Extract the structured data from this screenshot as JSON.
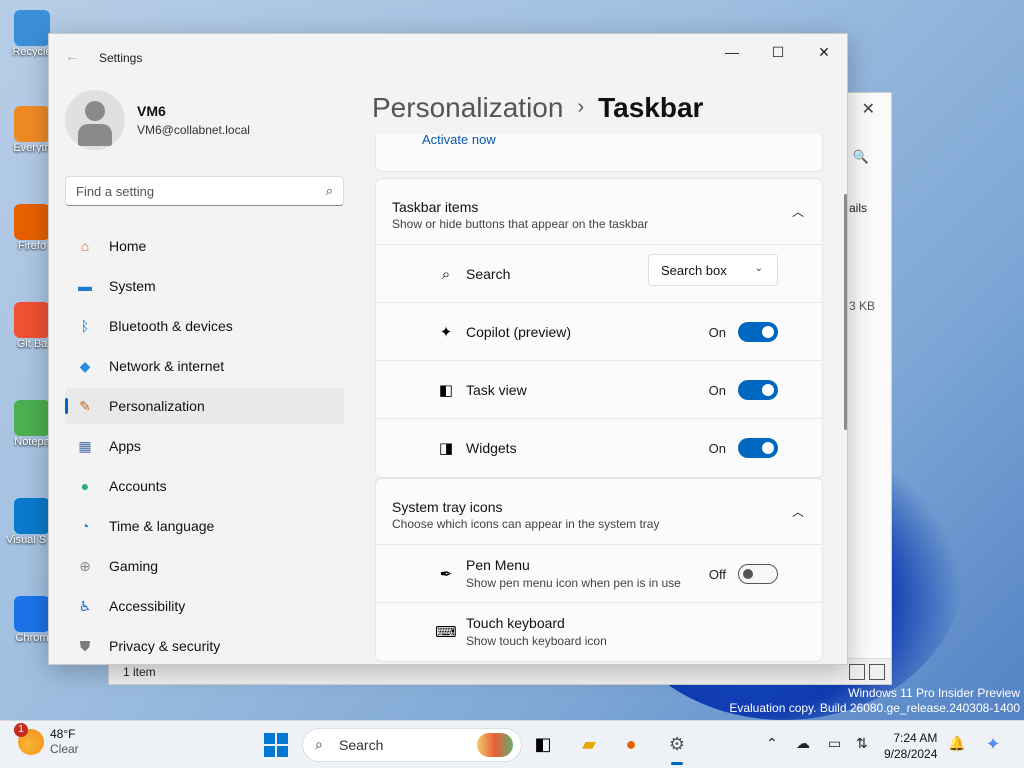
{
  "desktop": {
    "icons": [
      {
        "label": "Recycle",
        "icon": "recycle-bin-icon",
        "color": "#3a8fd8"
      },
      {
        "label": "Everyth",
        "icon": "everything-search-icon",
        "color": "#f08a24"
      },
      {
        "label": "Firefo",
        "icon": "firefox-icon",
        "color": "#e66000"
      },
      {
        "label": "Git Ba",
        "icon": "git-bash-icon",
        "color": "#f05033"
      },
      {
        "label": "Notepa",
        "icon": "notepad-icon",
        "color": "#4caf50"
      },
      {
        "label": "Visual S Code",
        "icon": "vscode-icon",
        "color": "#0a7acc"
      },
      {
        "label": "Chrom",
        "icon": "chrome-icon",
        "color": "#1a73e8"
      }
    ]
  },
  "explorer": {
    "close_glyph": "✕",
    "search_glyph": "🔍",
    "details_label": "ails",
    "size_label": "3 KB",
    "status_text": "1 item"
  },
  "settings": {
    "window_title": "Settings",
    "back_glyph": "←",
    "controls": {
      "minimize": "—",
      "maximize": "☐",
      "close": "✕"
    },
    "user": {
      "name": "VM6",
      "email": "VM6@collabnet.local"
    },
    "search": {
      "placeholder": "Find a setting",
      "glyph": "⌕"
    },
    "nav": [
      {
        "label": "Home",
        "icon": "home-icon",
        "glyph": "⌂",
        "color": "#e0683b",
        "active": false
      },
      {
        "label": "System",
        "icon": "system-icon",
        "glyph": "▬",
        "color": "#1a7fd4",
        "active": false
      },
      {
        "label": "Bluetooth & devices",
        "icon": "bluetooth-icon",
        "glyph": "ᛒ",
        "color": "#0a6fd8",
        "active": false
      },
      {
        "label": "Network & internet",
        "icon": "network-icon",
        "glyph": "◆",
        "color": "#2a8ce0",
        "active": false
      },
      {
        "label": "Personalization",
        "icon": "paintbrush-icon",
        "glyph": "✎",
        "color": "#b06a30",
        "active": true
      },
      {
        "label": "Apps",
        "icon": "apps-icon",
        "glyph": "▦",
        "color": "#4a6fa8",
        "active": false
      },
      {
        "label": "Accounts",
        "icon": "accounts-icon",
        "glyph": "●",
        "color": "#2aa88a",
        "active": false
      },
      {
        "label": "Time & language",
        "icon": "globe-clock-icon",
        "glyph": "◔",
        "color": "#2a7fd4",
        "active": false
      },
      {
        "label": "Gaming",
        "icon": "gamepad-icon",
        "glyph": "⊕",
        "color": "#8a8a8a",
        "active": false
      },
      {
        "label": "Accessibility",
        "icon": "accessibility-icon",
        "glyph": "♿",
        "color": "#1a6fd0",
        "active": false
      },
      {
        "label": "Privacy & security",
        "icon": "shield-icon",
        "glyph": "⛊",
        "color": "#7a7a7a",
        "active": false
      }
    ],
    "breadcrumb": {
      "parent": "Personalization",
      "separator": "›",
      "current": "Taskbar"
    },
    "activate_link": "Activate now",
    "taskbar_items": {
      "title": "Taskbar items",
      "subtitle": "Show or hide buttons that appear on the taskbar",
      "chevron": "︿",
      "rows": [
        {
          "label": "Search",
          "icon": "search-icon",
          "glyph": "⌕",
          "type": "dropdown",
          "value": "Search box",
          "chevron": "⌄"
        },
        {
          "label": "Copilot (preview)",
          "icon": "copilot-icon",
          "glyph": "✦",
          "type": "toggle",
          "state": "On",
          "on": true
        },
        {
          "label": "Task view",
          "icon": "task-view-icon",
          "glyph": "◧",
          "type": "toggle",
          "state": "On",
          "on": true
        },
        {
          "label": "Widgets",
          "icon": "widgets-icon",
          "glyph": "◨",
          "type": "toggle",
          "state": "On",
          "on": true
        }
      ]
    },
    "system_tray": {
      "title": "System tray icons",
      "subtitle": "Choose which icons can appear in the system tray",
      "chevron": "︿",
      "rows": [
        {
          "label": "Pen Menu",
          "sub": "Show pen menu icon when pen is in use",
          "icon": "pen-icon",
          "glyph": "✒",
          "type": "toggle",
          "state": "Off",
          "on": false
        },
        {
          "label": "Touch keyboard",
          "sub": "Show touch keyboard icon",
          "icon": "keyboard-icon",
          "glyph": "⌨",
          "type": "none"
        }
      ]
    }
  },
  "watermark": {
    "line1": "Windows 11 Pro Insider Preview",
    "line2": "Evaluation copy. Build 26080.ge_release.240308-1400"
  },
  "taskbar": {
    "weather": {
      "badge": "1",
      "temp": "48°F",
      "condition": "Clear"
    },
    "search_placeholder": "Search",
    "clock": {
      "time": "7:24 AM",
      "date": "9/28/2024"
    },
    "accent": "#0067c0"
  }
}
